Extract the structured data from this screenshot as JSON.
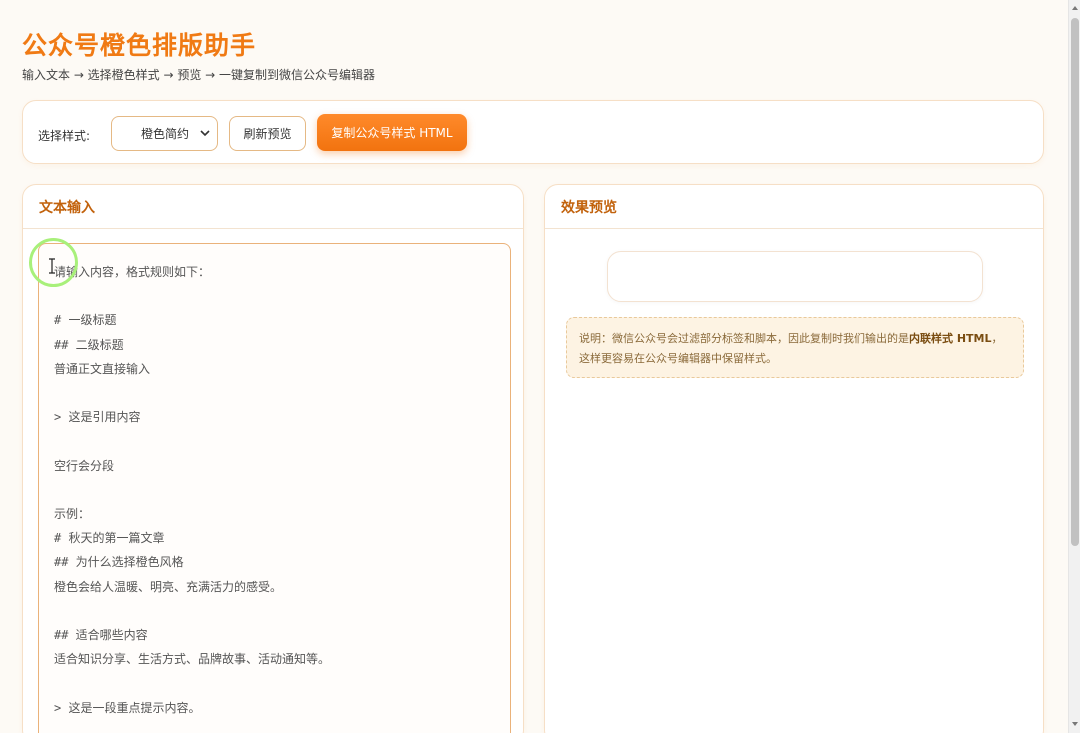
{
  "app": {
    "title": "公众号橙色排版助手",
    "subtitle": "输入文本 → 选择橙色样式 → 预览 → 一键复制到微信公众号编辑器"
  },
  "toolbar": {
    "style_label": "选择样式:",
    "style_selected": "橙色简约",
    "refresh_label": "刷新预览",
    "copy_label": "复制公众号样式 HTML"
  },
  "input_panel": {
    "title": "文本输入",
    "content": "请输入内容，格式规则如下：\n\n# 一级标题\n## 二级标题\n普通正文直接输入\n\n> 这是引用内容\n\n空行会分段\n\n示例：\n# 秋天的第一篇文章\n## 为什么选择橙色风格\n橙色会给人温暖、明亮、充满活力的感受。\n\n## 适合哪些内容\n适合知识分享、生活方式、品牌故事、活动通知等。\n\n> 这是一段重点提示内容。"
  },
  "preview_panel": {
    "title": "效果预览",
    "note_prefix": "说明：微信公众号会过滤部分标签和脚本，因此复制时我们输出的是",
    "note_bold": "内联样式 HTML",
    "note_suffix": "，这样更容易在公众号编辑器中保留样式。"
  },
  "colors": {
    "accent": "#f07a14",
    "header_text": "#c2620c",
    "button_gradient_start": "#ff8a2b",
    "button_gradient_end": "#f2730f",
    "border": "#f6dfc6",
    "note_bg": "#fdf3e3"
  },
  "icons": {
    "select_chevron": "chevron-down-icon",
    "cursor": "text-cursor-icon"
  }
}
